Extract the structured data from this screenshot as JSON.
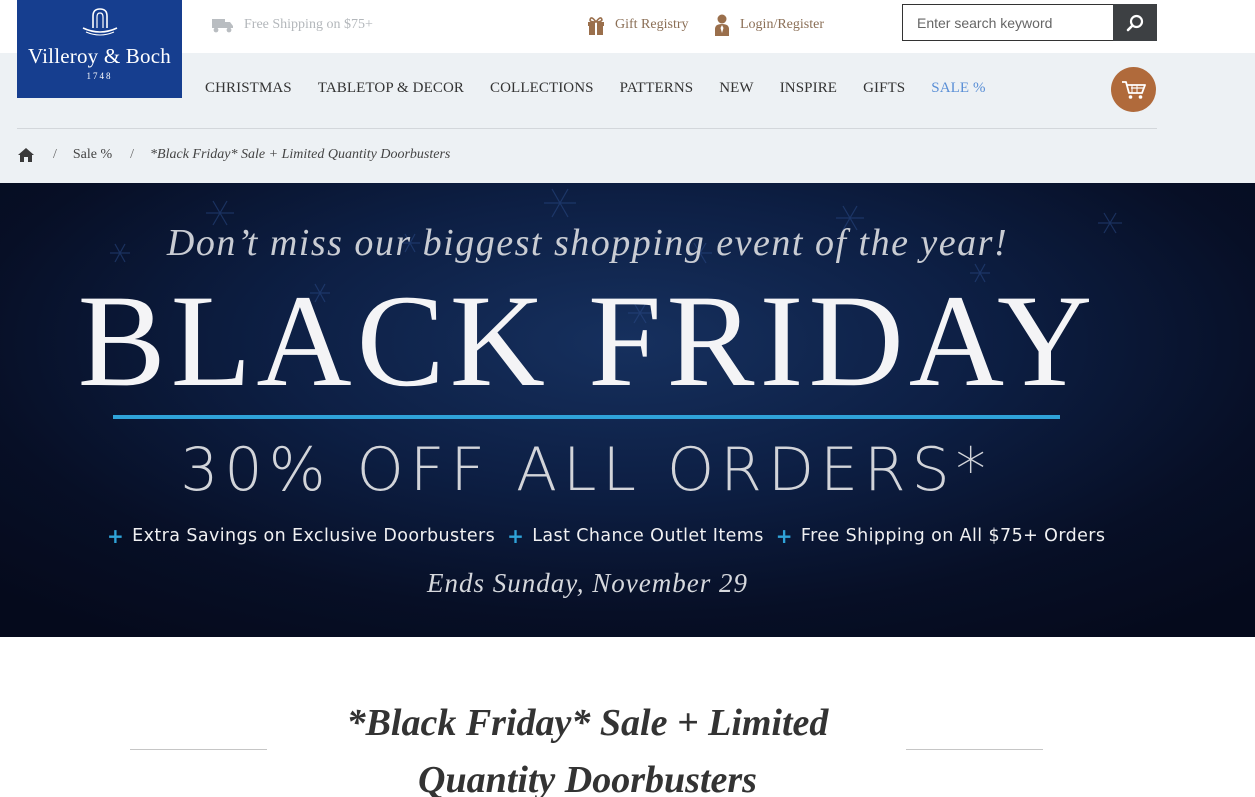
{
  "brand": {
    "name": "Villeroy & Boch",
    "year": "1748",
    "color": "#163e8f"
  },
  "utility": {
    "shipping": "Free Shipping on $75+",
    "registry": "Gift Registry",
    "login": "Login/Register"
  },
  "search": {
    "placeholder": "Enter search keyword"
  },
  "nav": {
    "items": [
      "CHRISTMAS",
      "TABLETOP & DECOR",
      "COLLECTIONS",
      "PATTERNS",
      "NEW",
      "INSPIRE",
      "GIFTS"
    ],
    "sale": "SALE %"
  },
  "breadcrumb": {
    "separator": "/",
    "parent": "Sale %",
    "current": "*Black Friday* Sale + Limited Quantity Doorbusters"
  },
  "banner": {
    "tagline": "Don’t miss our biggest shopping event of the year!",
    "headline": "BLACK FRIDAY",
    "offer": "30% OFF ALL ORDERS*",
    "perks": [
      "Extra Savings on Exclusive Doorbusters",
      "Last Chance Outlet Items",
      "Free Shipping on All $75+ Orders"
    ],
    "perk_marker": "+",
    "ends": "Ends Sunday, November 29",
    "accent_color": "#2fa3d9"
  },
  "page": {
    "title": "*Black Friday* Sale + Limited Quantity Doorbusters"
  },
  "colors": {
    "header_bg": "#edf1f4",
    "cart": "#b06a3b",
    "sale_link": "#5a8fd6",
    "utility_icon": "#8b6f56"
  }
}
